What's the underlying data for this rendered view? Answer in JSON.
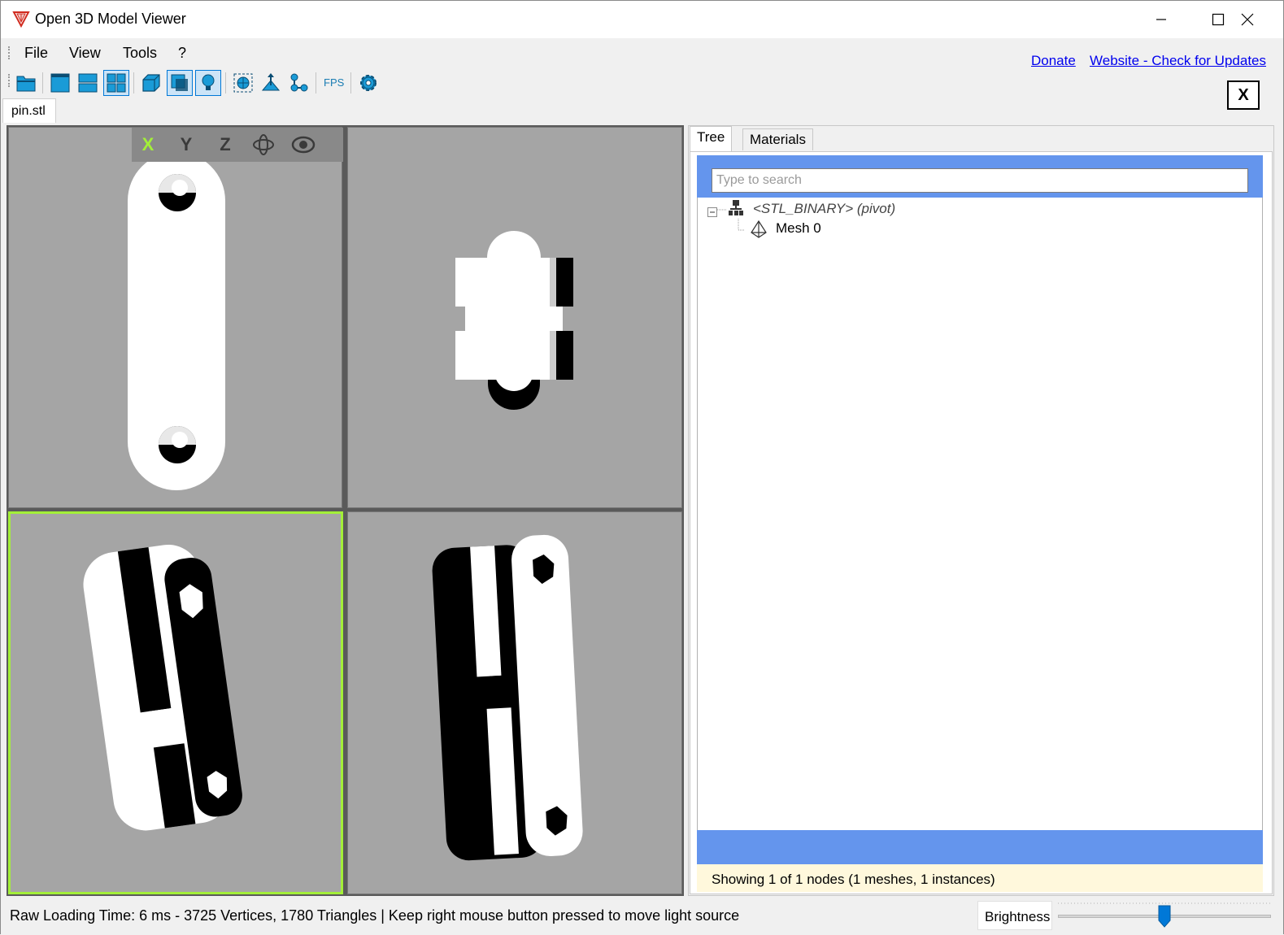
{
  "window": {
    "title": "Open 3D Model Viewer"
  },
  "menu": {
    "items": [
      "File",
      "View",
      "Tools",
      "?"
    ]
  },
  "links": {
    "donate": "Donate",
    "website": "Website - Check for Updates"
  },
  "toolbar": {
    "buttons": [
      "open-icon",
      "single-view-icon",
      "two-view-icon",
      "four-view-icon",
      "wireframe-icon",
      "textured-icon",
      "lighting-icon",
      "zoom-to-fit-icon",
      "normals-icon",
      "skeleton-icon",
      "fps-icon",
      "settings-icon"
    ],
    "fps_label": "FPS",
    "close_label": "X"
  },
  "document_tab": "pin.stl",
  "viewport": {
    "axis_buttons": [
      "X",
      "Y",
      "Z"
    ],
    "active_axis": "X",
    "active_border_color": "#a3ef38"
  },
  "panel": {
    "tabs": [
      "Tree",
      "Materials"
    ],
    "active_tab": "Tree",
    "search_placeholder": "Type to search",
    "tree": {
      "root": "<STL_BINARY> (pivot)",
      "children": [
        "Mesh 0"
      ]
    },
    "footer": "Showing 1 of 1 nodes (1 meshes, 1 instances)",
    "header_color": "#6495ed"
  },
  "statusbar": {
    "text": "Raw Loading Time: 6 ms - 3725 Vertices, 1780 Triangles  | Keep right mouse button pressed to move light source",
    "brightness_label": "Brightness",
    "brightness_level": 0.5
  }
}
